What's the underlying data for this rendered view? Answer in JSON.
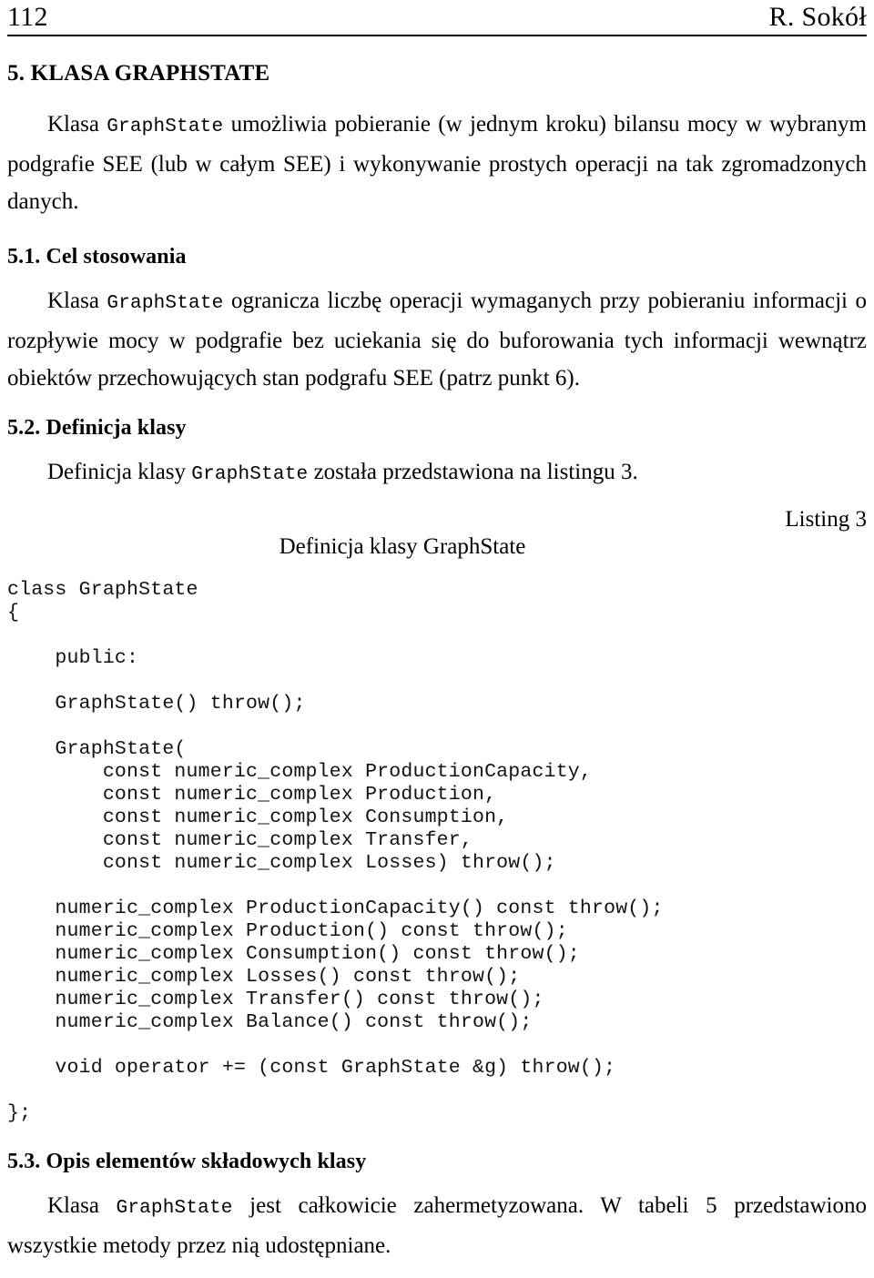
{
  "page": {
    "running_head": {
      "folio": "112",
      "author": "R. Sokół"
    }
  },
  "sections": {
    "main_heading": "5. KLASA GRAPHSTATE",
    "intro_paragraph": {
      "lead": "Klasa ",
      "code_term": "GraphState",
      "rest": " umożliwia pobieranie (w jednym kroku) bilansu mocy w wybranym podgrafie SEE (lub w całym SEE) i wykonywanie prostych operacji na tak zgromadzonych danych."
    },
    "subsection_5_1": {
      "heading": "5.1. Cel stosowania",
      "paragraph": {
        "lead": "Klasa ",
        "code_term": "GraphState",
        "rest": " ogranicza liczbę operacji wymaganych przy pobieraniu informacji o rozpływie mocy w podgrafie bez uciekania się do buforowania tych informacji wewnątrz obiektów przechowujących stan podgrafu SEE (patrz punkt 6)."
      }
    },
    "subsection_5_2": {
      "heading": "5.2. Definicja klasy",
      "paragraph": {
        "lead": "Definicja klasy ",
        "code_term": "GraphState",
        "rest": " została przedstawiona na listingu 3."
      },
      "listing_label": "Listing 3",
      "listing_title": "Definicja klasy GraphState",
      "listing_code": "class GraphState\n{\n\n    public:\n\n    GraphState() throw();\n\n    GraphState(\n        const numeric_complex ProductionCapacity,\n        const numeric_complex Production,\n        const numeric_complex Consumption,\n        const numeric_complex Transfer,\n        const numeric_complex Losses) throw();\n\n    numeric_complex ProductionCapacity() const throw();\n    numeric_complex Production() const throw();\n    numeric_complex Consumption() const throw();\n    numeric_complex Losses() const throw();\n    numeric_complex Transfer() const throw();\n    numeric_complex Balance() const throw();\n\n    void operator += (const GraphState &g) throw();\n\n};"
    },
    "subsection_5_3": {
      "heading": "5.3. Opis elementów składowych klasy",
      "paragraph": {
        "lead": "Klasa ",
        "code_term": "GraphState",
        "rest": " jest całkowicie zahermetyzowana. W tabeli 5 przedstawiono wszystkie metody przez nią udostępniane."
      }
    }
  }
}
